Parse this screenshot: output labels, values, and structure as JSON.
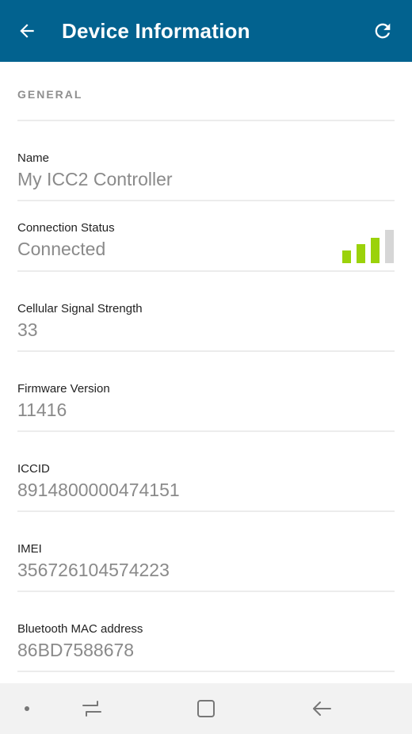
{
  "header": {
    "title": "Device Information",
    "back_icon": "arrow-back-icon",
    "refresh_icon": "refresh-icon"
  },
  "section": {
    "title": "GENERAL"
  },
  "fields": {
    "name": {
      "label": "Name",
      "value": "My ICC2 Controller"
    },
    "connection": {
      "label": "Connection Status",
      "value": "Connected",
      "signal_bars_active": 3,
      "signal_bars_total": 4
    },
    "cellular": {
      "label": "Cellular Signal Strength",
      "value": "33"
    },
    "firmware": {
      "label": "Firmware Version",
      "value": "11416"
    },
    "iccid": {
      "label": "ICCID",
      "value": "8914800000474151"
    },
    "imei": {
      "label": "IMEI",
      "value": "356726104574223"
    },
    "bluetooth": {
      "label": "Bluetooth MAC address",
      "value": "86BD7588678"
    }
  },
  "colors": {
    "appbar": "#02628f",
    "signal_active": "#9bd20a",
    "signal_inactive": "#d6d6d6",
    "navbar": "#f2f2f2"
  },
  "navbar": {
    "dot_icon": "dot-icon",
    "recents_icon": "recents-icon",
    "home_icon": "home-icon",
    "back_icon": "back-icon"
  }
}
